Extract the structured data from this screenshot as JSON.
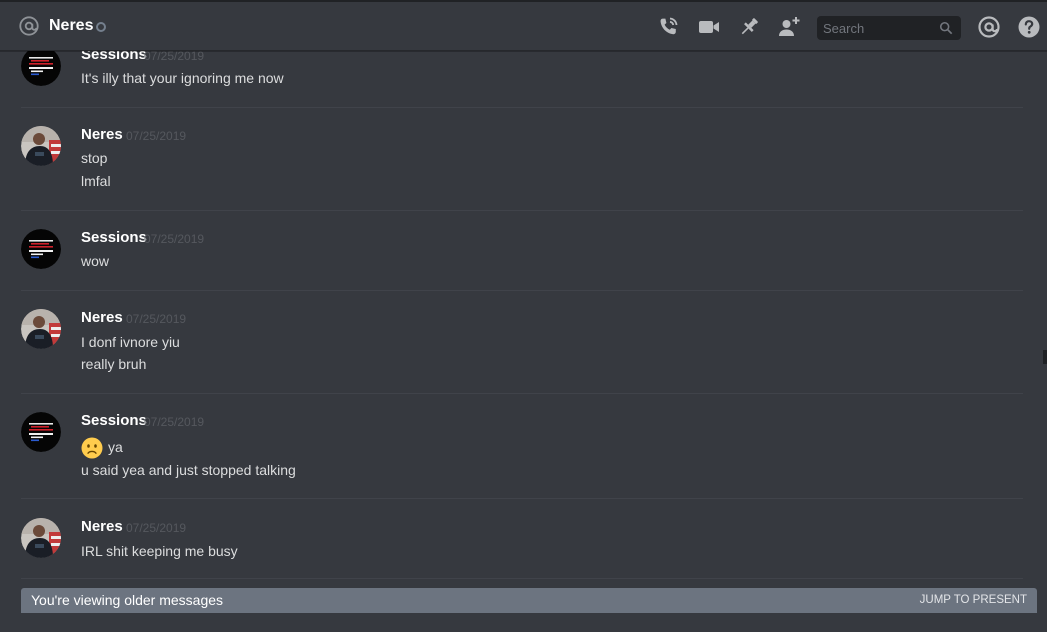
{
  "header": {
    "channel_icon": "at-icon",
    "channel_name": "Neres",
    "status": "offline",
    "actions": [
      "call-icon",
      "video-icon",
      "pin-icon",
      "add-friend-icon"
    ],
    "search": {
      "placeholder": "Search",
      "value": ""
    },
    "right_icons": [
      "mentions-icon",
      "help-icon"
    ]
  },
  "messages": [
    {
      "author": "Sessions",
      "timestamp": "07/25/2019",
      "lines": [
        "It's illy that your ignoring me now"
      ]
    },
    {
      "author": "Neres",
      "timestamp": "07/25/2019",
      "lines": [
        "stop",
        "lmfal"
      ]
    },
    {
      "author": "Sessions",
      "timestamp": "07/25/2019",
      "lines": [
        "wow"
      ]
    },
    {
      "author": "Neres",
      "timestamp": "07/25/2019",
      "lines": [
        "I donf ivnore yiu",
        "really bruh"
      ]
    },
    {
      "author": "Sessions",
      "timestamp": "07/25/2019",
      "lines": [
        "ya",
        "u said yea and just stopped talking"
      ],
      "emoji": "frowning-face-emoji"
    },
    {
      "author": "Neres",
      "timestamp": "07/25/2019",
      "lines": [
        "IRL shit keeping me busy"
      ]
    }
  ],
  "older_bar": {
    "text": "You're viewing older messages",
    "jump_label": "JUMP TO PRESENT"
  },
  "colors": {
    "background": "#36393f",
    "header_border": "#202225",
    "author": "#ffffff",
    "message_text": "#dcddde",
    "timestamp": "#55585e",
    "older_bar": "#6c7480"
  }
}
